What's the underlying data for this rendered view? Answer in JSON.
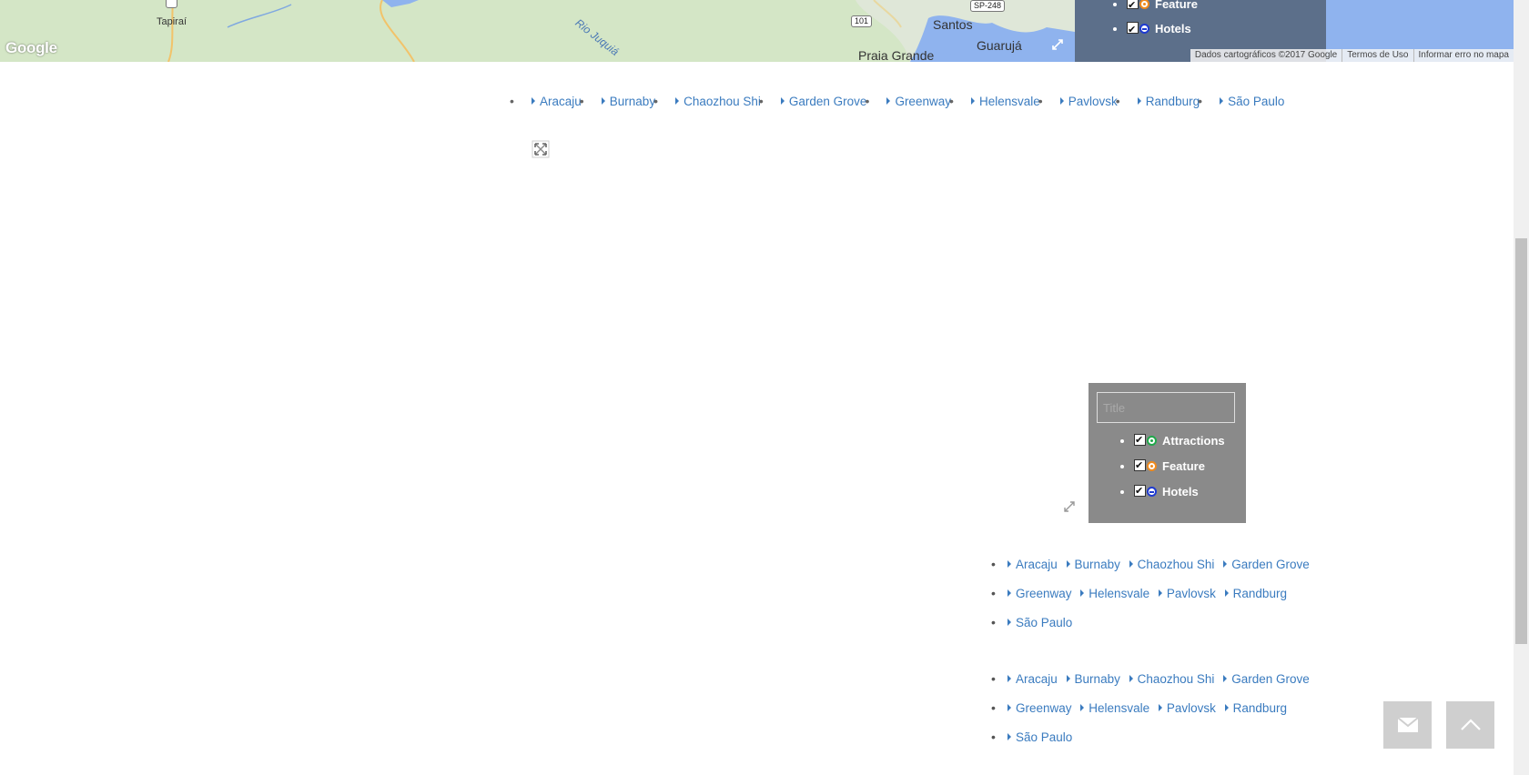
{
  "map": {
    "labels": {
      "tapirai": "Tapiraí",
      "santos": "Santos",
      "guaruja": "Guarujá",
      "praia_grande": "Praia Grande",
      "river": "Rio Juquiá"
    },
    "road_shields": {
      "r101": "101",
      "sp248": "SP-248"
    },
    "google_logo": "Google",
    "attribution": {
      "data": "Dados cartográficos ©2017 Google",
      "terms": "Termos de Uso",
      "report": "Informar erro no mapa"
    },
    "legend_items": [
      {
        "label": "Feature",
        "pin": "orange"
      },
      {
        "label": "Hotels",
        "pin": "blue"
      }
    ]
  },
  "city_row": [
    "Aracaju",
    "Burnaby",
    "Chaozhou Shi",
    "Garden Grove",
    "Greenway",
    "Helensvale",
    "Pavlovsk",
    "Randburg",
    "São Paulo"
  ],
  "legend_panel": {
    "title_placeholder": "Title",
    "items": [
      {
        "label": "Attractions",
        "pin": "green"
      },
      {
        "label": "Feature",
        "pin": "orange"
      },
      {
        "label": "Hotels",
        "pin": "blue"
      }
    ]
  },
  "city_block_1": [
    [
      "Aracaju",
      "Burnaby",
      "Chaozhou Shi",
      "Garden Grove"
    ],
    [
      "Greenway",
      "Helensvale",
      "Pavlovsk",
      "Randburg"
    ],
    [
      "São Paulo"
    ]
  ],
  "city_block_2": [
    [
      "Aracaju",
      "Burnaby",
      "Chaozhou Shi",
      "Garden Grove"
    ],
    [
      "Greenway",
      "Helensvale",
      "Pavlovsk",
      "Randburg"
    ],
    [
      "São Paulo"
    ]
  ],
  "buttons": {
    "contact_icon": "envelope-icon",
    "top_icon": "chevron-up-icon"
  },
  "colors": {
    "link": "#3a7bbf",
    "legend_panel_bg": "#8a8a8a",
    "map_legend_bg": "#5c6f8a",
    "fab_bg": "#cfcfcf"
  }
}
